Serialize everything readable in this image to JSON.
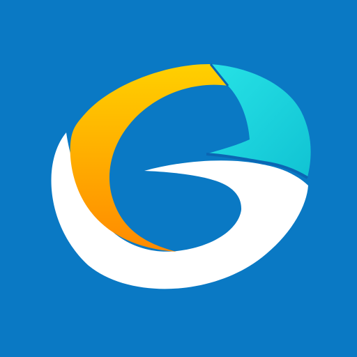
{
  "icon": {
    "name": "stylized-g-logo-icon",
    "colors": {
      "background": "#0a79c4",
      "white_swoosh": "#ffffff",
      "orange_gradient_start": "#ffd000",
      "orange_gradient_end": "#ff8a00",
      "cyan_segment": "#16d0db",
      "separator_outline": "#0b66b3"
    }
  }
}
